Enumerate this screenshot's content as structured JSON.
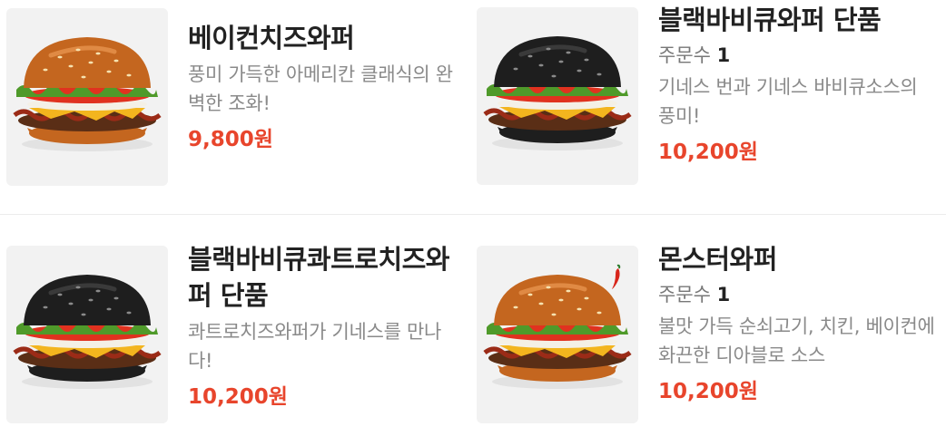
{
  "menu_items": [
    {
      "name": "베이컨치즈와퍼",
      "count_label": null,
      "count_value": null,
      "description": "풍미 가득한 아메리칸 클래식의 완벽한 조화!",
      "price": "9,800원",
      "bun_color": "#c4661f",
      "icon": "burger-image"
    },
    {
      "name": "블랙바비큐와퍼 단품",
      "count_label": "주문수",
      "count_value": "1",
      "description": "기네스 번과 기네스 바비큐소스의 풍미!",
      "price": "10,200원",
      "bun_color": "#1e1e1e",
      "icon": "burger-image"
    },
    {
      "name": "블랙바비큐콰트로치즈와퍼 단품",
      "count_label": null,
      "count_value": null,
      "description": "콰트로치즈와퍼가 기네스를 만나다!",
      "price": "10,200원",
      "bun_color": "#1e1e1e",
      "icon": "burger-image"
    },
    {
      "name": "몬스터와퍼",
      "count_label": "주문수",
      "count_value": "1",
      "description": "불맛 가득 순쇠고기, 치킨, 베이컨에 화끈한 디아블로 소스",
      "price": "10,200원",
      "bun_color": "#c4661f",
      "icon": "burger-image",
      "badge_icon": "chili-pepper-icon"
    }
  ],
  "colors": {
    "price": "#e8452c",
    "thumb_background": "#f2f2f2",
    "description": "#8a8a8a"
  }
}
